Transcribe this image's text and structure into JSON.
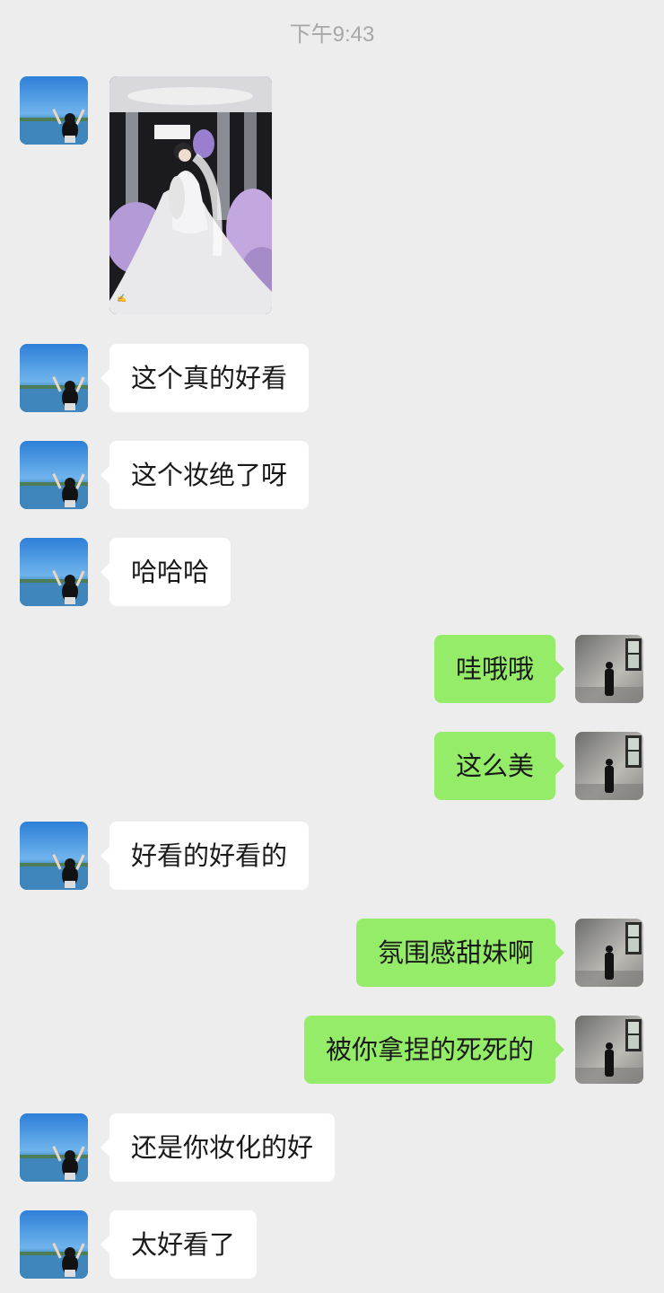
{
  "chat": {
    "timestamp": "下午9:43",
    "messages": [
      {
        "side": "in",
        "type": "image",
        "image_alt": "wedding-photo"
      },
      {
        "side": "in",
        "type": "text",
        "text": "这个真的好看"
      },
      {
        "side": "in",
        "type": "text",
        "text": "这个妆绝了呀"
      },
      {
        "side": "in",
        "type": "text",
        "text": "哈哈哈"
      },
      {
        "side": "out",
        "type": "text",
        "text": "哇哦哦"
      },
      {
        "side": "out",
        "type": "text",
        "text": "这么美"
      },
      {
        "side": "in",
        "type": "text",
        "text": "好看的好看的"
      },
      {
        "side": "out",
        "type": "text",
        "text": "氛围感甜妹啊"
      },
      {
        "side": "out",
        "type": "text",
        "text": "被你拿捏的死死的"
      },
      {
        "side": "in",
        "type": "text",
        "text": "还是你妆化的好"
      },
      {
        "side": "in",
        "type": "text",
        "text": "太好看了"
      }
    ]
  },
  "colors": {
    "background": "#ededed",
    "incoming_bubble": "#ffffff",
    "outgoing_bubble": "#95ec69",
    "text": "#191919",
    "timestamp": "#a7a7a7"
  },
  "icons": {
    "contact_avatar": "lake-sky-avatar",
    "self_avatar": "wall-figure-avatar"
  }
}
